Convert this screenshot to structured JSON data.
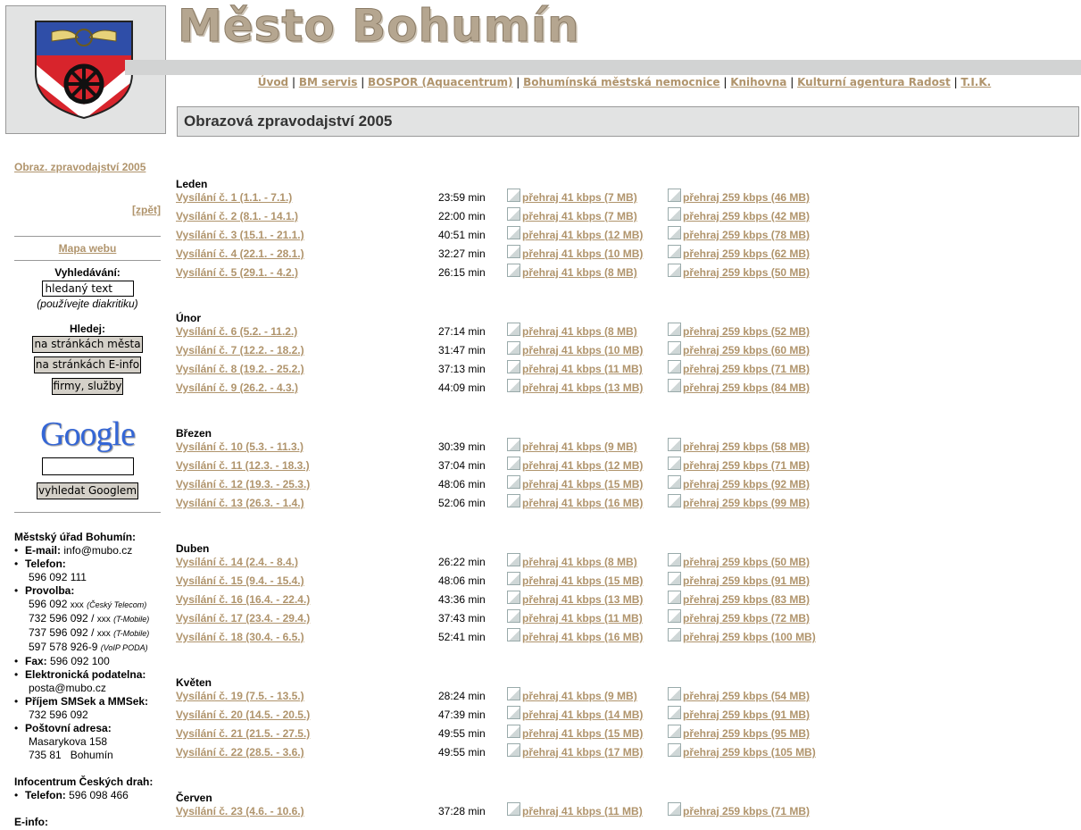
{
  "header": {
    "title": "Město Bohumín",
    "page_heading": "Obrazová zpravodajství 2005"
  },
  "topnav": [
    "Úvod",
    "BM servis",
    "BOSPOR (Aquacentrum)",
    "Bohumínská městská nemocnice",
    "Knihovna",
    "Kulturní agentura Radost",
    "T.I.K."
  ],
  "sidebar": {
    "current": "Obraz. zpravodajství 2005",
    "back": "[zpět]",
    "sitemap": "Mapa webu",
    "search_label": "Vyhledávání:",
    "search_value": "hledaný text",
    "search_hint": "(používejte diakritiku)",
    "find_label": "Hledej:",
    "btn_city": "na stránkách města",
    "btn_einfo": "na stránkách E-info",
    "btn_firms": "firmy, služby",
    "google_logo": "Google",
    "google_btn": "vyhledat Googlem",
    "contact": {
      "office": "Městský úřad Bohumín:",
      "email_label": "E-mail:",
      "email": "info@mubo.cz",
      "phone_label": "Telefon:",
      "phone": "596 092 111",
      "direct_label": "Provolba:",
      "direct1": "596 092",
      "direct1_x": "xxx",
      "direct1_op": "(Český Telecom)",
      "direct2": "732 596 092 /",
      "direct2_x": "xxx",
      "direct2_op": "(T-Mobile)",
      "direct3": "737 596 092 /",
      "direct3_x": "xxx",
      "direct3_op": "(T-Mobile)",
      "direct4": "597 578 926-9",
      "direct4_op": "(VoIP PODA)",
      "fax_label": "Fax:",
      "fax": "596 092 100",
      "epod_label": "Elektronická podatelna:",
      "epod": "posta@mubo.cz",
      "sms_label": "Příjem SMSek a MMSek:",
      "sms": "732 596 092",
      "post_label": "Poštovní adresa:",
      "post1": "Masarykova 158",
      "post2": "735 81   Bohumín",
      "cd": "Infocentrum Českých drah:",
      "cd_phone_label": "Telefon:",
      "cd_phone": "596 098 466",
      "einfo": "E-info:"
    }
  },
  "months": [
    {
      "name": "Leden",
      "rows": [
        {
          "ep": "Vysílání č. 1 (1.1. - 7.1.)",
          "dur": "23:59 min",
          "l41": "přehraj 41 kbps (7 MB)",
          "l259": "přehraj 259 kbps (46 MB)"
        },
        {
          "ep": "Vysílání č. 2 (8.1. - 14.1.)",
          "dur": "22:00 min",
          "l41": "přehraj 41 kbps (7 MB)",
          "l259": "přehraj 259 kbps (42 MB)"
        },
        {
          "ep": "Vysílání č. 3 (15.1. - 21.1.)",
          "dur": "40:51 min",
          "l41": "přehraj 41 kbps (12 MB)",
          "l259": "přehraj 259 kbps (78 MB)"
        },
        {
          "ep": "Vysílání č. 4 (22.1. - 28.1.)",
          "dur": "32:27 min",
          "l41": "přehraj 41 kbps (10 MB)",
          "l259": "přehraj 259 kbps (62 MB)"
        },
        {
          "ep": "Vysílání č. 5 (29.1. - 4.2.)",
          "dur": "26:15 min",
          "l41": "přehraj 41 kbps (8 MB)",
          "l259": "přehraj 259 kbps (50 MB)"
        }
      ]
    },
    {
      "name": "Únor",
      "rows": [
        {
          "ep": "Vysílání č. 6 (5.2. - 11.2.)",
          "dur": "27:14 min",
          "l41": "přehraj 41 kbps (8 MB)",
          "l259": "přehraj 259 kbps (52 MB)"
        },
        {
          "ep": "Vysílání č. 7 (12.2. - 18.2.)",
          "dur": "31:47 min",
          "l41": "přehraj 41 kbps (10 MB)",
          "l259": "přehraj 259 kbps (60 MB)"
        },
        {
          "ep": "Vysílání č. 8 (19.2. - 25.2.)",
          "dur": "37:13 min",
          "l41": "přehraj 41 kbps (11 MB)",
          "l259": "přehraj 259 kbps (71 MB)"
        },
        {
          "ep": "Vysílání č. 9 (26.2. - 4.3.)",
          "dur": "44:09 min",
          "l41": "přehraj 41 kbps (13 MB)",
          "l259": "přehraj 259 kbps (84 MB)"
        }
      ]
    },
    {
      "name": "Březen",
      "rows": [
        {
          "ep": "Vysílání č. 10 (5.3. - 11.3.)",
          "dur": "30:39 min",
          "l41": "přehraj 41 kbps (9 MB)",
          "l259": "přehraj 259 kbps (58 MB)"
        },
        {
          "ep": "Vysílání č. 11 (12.3. - 18.3.)",
          "dur": "37:04 min",
          "l41": "přehraj 41 kbps (12 MB)",
          "l259": "přehraj 259 kbps (71 MB)"
        },
        {
          "ep": "Vysílání č. 12 (19.3. - 25.3.)",
          "dur": "48:06 min",
          "l41": "přehraj 41 kbps (15 MB)",
          "l259": "přehraj 259 kbps (92 MB)"
        },
        {
          "ep": "Vysílání č. 13 (26.3. - 1.4.)",
          "dur": "52:06 min",
          "l41": "přehraj 41 kbps (16 MB)",
          "l259": "přehraj 259 kbps (99 MB)"
        }
      ]
    },
    {
      "name": "Duben",
      "rows": [
        {
          "ep": "Vysílání č. 14 (2.4. - 8.4.)",
          "dur": "26:22 min",
          "l41": "přehraj 41 kbps (8 MB)",
          "l259": "přehraj 259 kbps (50 MB)"
        },
        {
          "ep": "Vysílání č. 15 (9.4. - 15.4.)",
          "dur": "48:06 min",
          "l41": "přehraj 41 kbps (15 MB)",
          "l259": "přehraj 259 kbps (91 MB)"
        },
        {
          "ep": "Vysílání č. 16 (16.4. - 22.4.)",
          "dur": "43:36 min",
          "l41": "přehraj 41 kbps (13 MB)",
          "l259": "přehraj 259 kbps (83 MB)"
        },
        {
          "ep": "Vysílání č. 17 (23.4. - 29.4.)",
          "dur": "37:43 min",
          "l41": "přehraj 41 kbps (11 MB)",
          "l259": "přehraj 259 kbps (72 MB)"
        },
        {
          "ep": "Vysílání č. 18 (30.4. - 6.5.)",
          "dur": "52:41 min",
          "l41": "přehraj 41 kbps (16 MB)",
          "l259": "přehraj 259 kbps (100 MB)"
        }
      ]
    },
    {
      "name": "Květen",
      "rows": [
        {
          "ep": "Vysílání č. 19 (7.5. - 13.5.)",
          "dur": "28:24 min",
          "l41": "přehraj 41 kbps (9 MB)",
          "l259": "přehraj 259 kbps (54 MB)"
        },
        {
          "ep": "Vysílání č. 20 (14.5. - 20.5.)",
          "dur": "47:39 min",
          "l41": "přehraj 41 kbps (14 MB)",
          "l259": "přehraj 259 kbps (91 MB)"
        },
        {
          "ep": "Vysílání č. 21 (21.5. - 27.5.)",
          "dur": "49:55 min",
          "l41": "přehraj 41 kbps (15 MB)",
          "l259": "přehraj 259 kbps (95 MB)"
        },
        {
          "ep": "Vysílání č. 22 (28.5. - 3.6.)",
          "dur": "49:55 min",
          "l41": "přehraj 41 kbps (17 MB)",
          "l259": "přehraj 259 kbps (105 MB)"
        }
      ]
    },
    {
      "name": "Červen",
      "rows": [
        {
          "ep": "Vysílání č. 23 (4.6. - 10.6.)",
          "dur": "37:28 min",
          "l41": "přehraj 41 kbps (11 MB)",
          "l259": "přehraj 259 kbps (71 MB)"
        }
      ]
    }
  ]
}
